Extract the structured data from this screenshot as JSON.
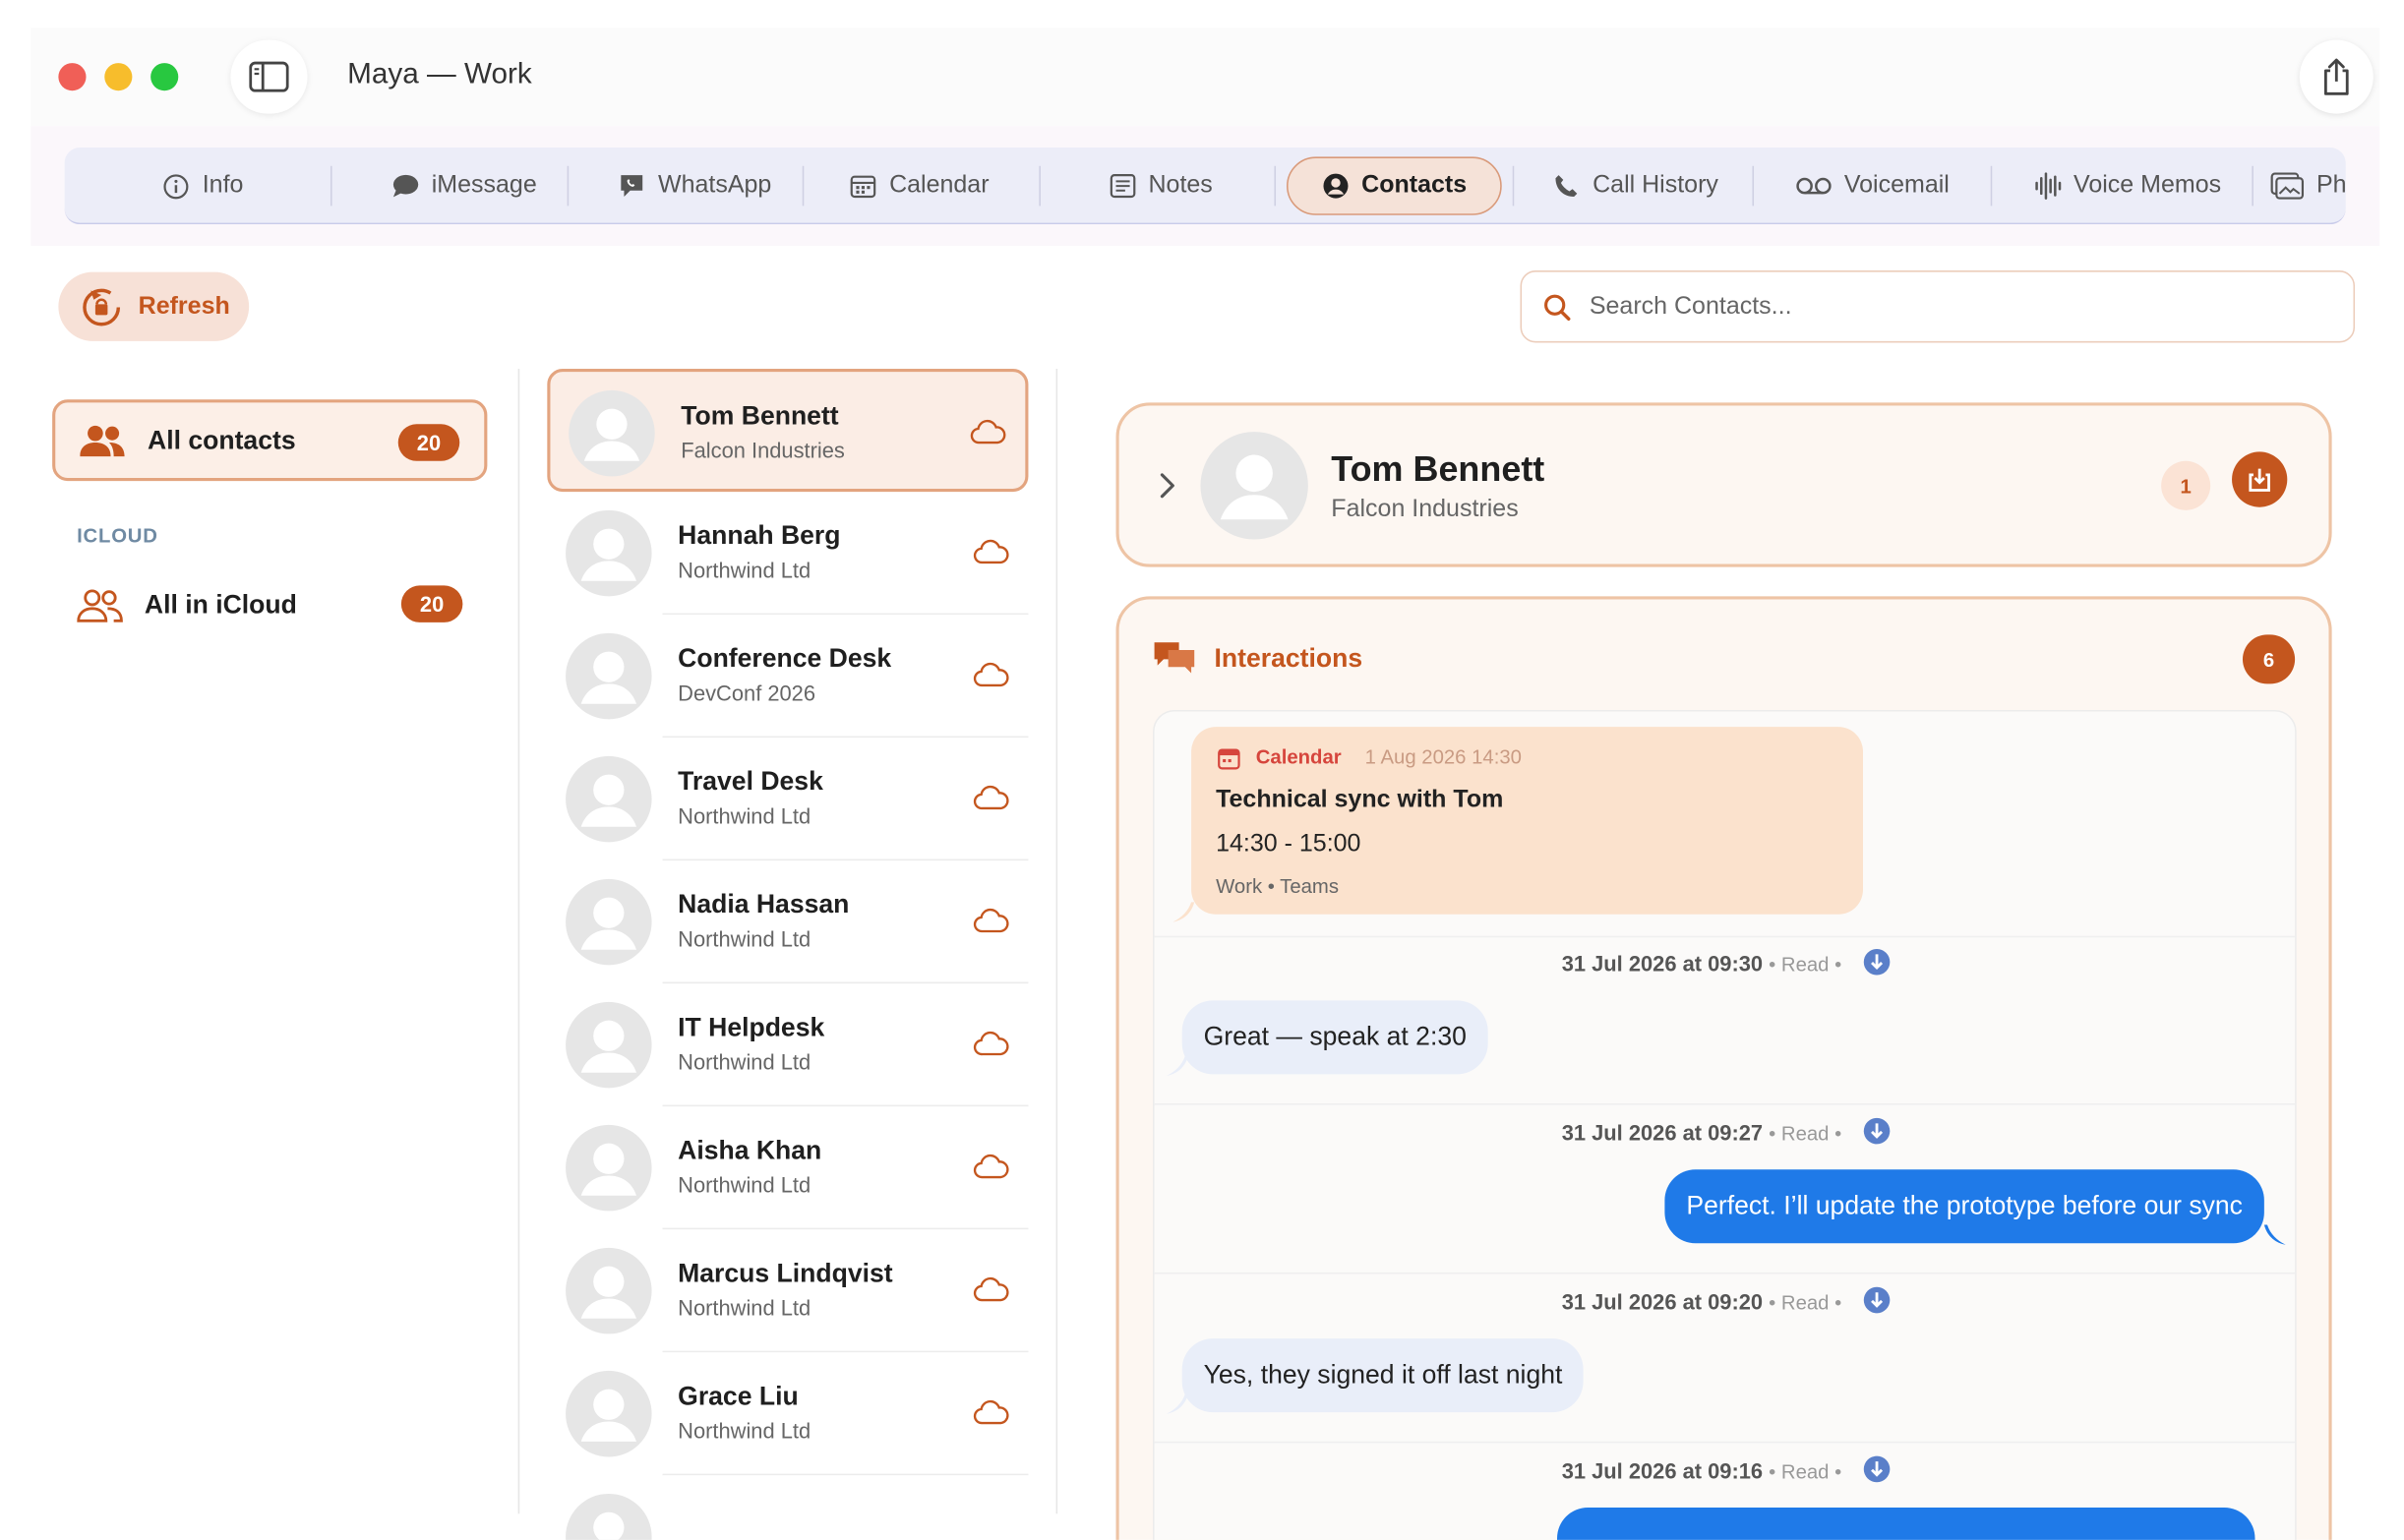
{
  "window": {
    "title": "Maya — Work"
  },
  "tabs": [
    {
      "label": "Info",
      "icon": "info-icon"
    },
    {
      "label": "iMessage",
      "icon": "message-bubble-icon"
    },
    {
      "label": "WhatsApp",
      "icon": "whatsapp-bubble-icon"
    },
    {
      "label": "Calendar",
      "icon": "calendar-icon"
    },
    {
      "label": "Notes",
      "icon": "notes-icon"
    },
    {
      "label": "Contacts",
      "icon": "person-circle-icon",
      "active": true
    },
    {
      "label": "Call History",
      "icon": "phone-icon"
    },
    {
      "label": "Voicemail",
      "icon": "voicemail-icon"
    },
    {
      "label": "Voice Memos",
      "icon": "waveform-icon"
    },
    {
      "label": "Ph",
      "icon": "photos-icon"
    }
  ],
  "toolbar": {
    "refresh_label": "Refresh",
    "search_placeholder": "Search Contacts..."
  },
  "groups": {
    "all": {
      "label": "All contacts",
      "count": "20"
    },
    "section_label": "ICLOUD",
    "icloud": {
      "label": "All in iCloud",
      "count": "20"
    }
  },
  "contacts": [
    {
      "name": "Tom Bennett",
      "org": "Falcon Industries"
    },
    {
      "name": "Hannah Berg",
      "org": "Northwind Ltd"
    },
    {
      "name": "Conference Desk",
      "org": "DevConf 2026"
    },
    {
      "name": "Travel Desk",
      "org": "Northwind Ltd"
    },
    {
      "name": "Nadia Hassan",
      "org": "Northwind Ltd"
    },
    {
      "name": "IT Helpdesk",
      "org": "Northwind Ltd"
    },
    {
      "name": "Aisha Khan",
      "org": "Northwind Ltd"
    },
    {
      "name": "Marcus Lindqvist",
      "org": "Northwind Ltd"
    },
    {
      "name": "Grace Liu",
      "org": "Northwind Ltd"
    }
  ],
  "detail": {
    "name": "Tom Bennett",
    "org": "Falcon Industries",
    "count": "1",
    "interactions_label": "Interactions",
    "interactions_count": "6",
    "calendar": {
      "tag": "Calendar",
      "date": "1 Aug 2026 14:30",
      "title": "Technical sync with Tom",
      "time": "14:30 - 15:00",
      "meta": "Work • Teams"
    },
    "messages": [
      {
        "timestamp": "31 Jul 2026 at 09:30",
        "status": "• Read •",
        "text": "Great — speak at 2:30",
        "direction": "in"
      },
      {
        "timestamp": "31 Jul 2026 at 09:27",
        "status": "• Read •",
        "text": "Perfect. I’ll update the prototype before our sync",
        "direction": "out"
      },
      {
        "timestamp": "31 Jul 2026 at 09:20",
        "status": "• Read •",
        "text": "Yes, they signed it off last night",
        "direction": "in"
      },
      {
        "timestamp": "31 Jul 2026 at 09:16",
        "status": "• Read •",
        "text": "",
        "direction": "out"
      }
    ]
  },
  "colors": {
    "accent": "#c4561e",
    "outgoing_bubble": "#1f7ae8",
    "incoming_bubble": "#e9eef9",
    "calendar_card": "#fbe2cd"
  }
}
